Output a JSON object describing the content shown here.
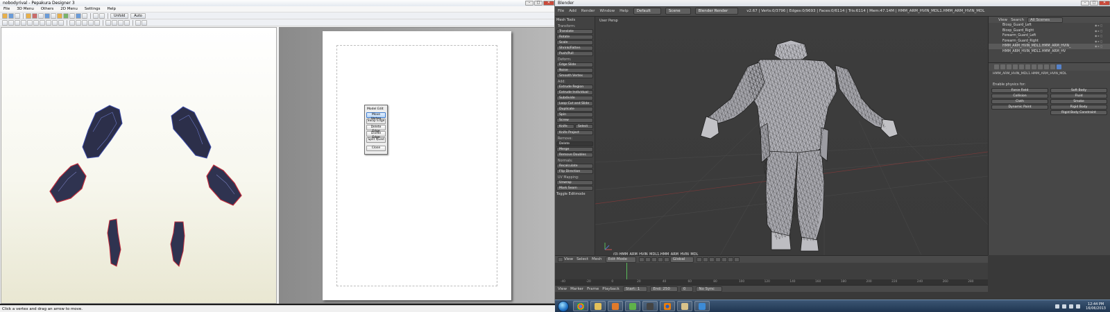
{
  "pepakura": {
    "title": "nobodyrival - Pepakura Designer 3",
    "menu": [
      "File",
      "3D Menu",
      "Others",
      "2D Menu",
      "Settings",
      "Help"
    ],
    "toolbar_labels": {
      "unfold": "Unfold",
      "auto": "Auto"
    },
    "model_edit": {
      "title": "Model Edit",
      "buttons": [
        "Move Vertex",
        "Swap Edge",
        "Delete Edge",
        "Divide Edge",
        "Split Quad"
      ],
      "close": "Close"
    },
    "status": "Click a vertex and drag an arrow to move."
  },
  "blender": {
    "title": "Blender",
    "menus": [
      "File",
      "Add",
      "Render",
      "Window",
      "Help"
    ],
    "layout": "Default",
    "scene": "Scene",
    "engine": "Blender Render",
    "stats": "v2.67 | Verts:0/3796 | Edges:0/9693 | Faces:0/6114 | Tris:6114 | Mem:47.14M | HMM_ARM_HVIN_MDL1.HMM_ARM_HVIN_MDL",
    "tools": {
      "header": "Mesh Tools",
      "sections": [
        {
          "title": "Transform:",
          "buttons": [
            "Translate",
            "Rotate",
            "Scale",
            "Shrink/Fatten",
            "Push/Pull"
          ]
        },
        {
          "title": "Deform:",
          "buttons": [
            "Edge Slide",
            "Noise",
            "Smooth Vertex"
          ]
        },
        {
          "title": "Add:",
          "buttons": [
            "Extrude Region",
            "Extrude Individual",
            "Subdivide",
            "Loop Cut and Slide",
            "Duplicate",
            "Spin",
            "Screw"
          ]
        },
        {
          "title": "",
          "buttons": [
            "Knife Project"
          ]
        },
        {
          "title": "Remove:",
          "buttons": [
            "Merge",
            "Remove Doubles"
          ]
        },
        {
          "title": "Normals:",
          "buttons": [
            "Recalculate",
            "Flip Direction"
          ]
        },
        {
          "title": "UV Mapping:",
          "buttons": [
            "Unwrap",
            "Mark Seam"
          ]
        }
      ],
      "knife": "Knife",
      "select": "Select",
      "delete": "Delete",
      "toggle": "Toggle Editmode"
    },
    "viewport": {
      "label": "User Persp",
      "object": "(0) HMM_ARM_HVIN_MDL1.HMM_ARM_HVIN_MDL"
    },
    "view_header": {
      "menus": [
        "View",
        "Select",
        "Mesh"
      ],
      "mode": "Edit Mode",
      "orientation": "Global"
    },
    "timeline": {
      "menus": [
        "View",
        "Marker",
        "Frame",
        "Playback"
      ],
      "start": "Start: 1",
      "end": "End: 250",
      "current": "0",
      "sync": "No Sync",
      "ruler": [
        "-40",
        "-20",
        "0",
        "20",
        "40",
        "60",
        "80",
        "100",
        "120",
        "140",
        "160",
        "180",
        "200",
        "220",
        "240",
        "260",
        "280"
      ]
    },
    "outliner": {
      "menus": [
        "View",
        "Search"
      ],
      "scope": "All Scenes",
      "items": [
        "Bicep_Guard_Left",
        "Bicep_Guard_Right",
        "Forearm_Guard_Left",
        "Forearm_Guard_Right",
        "HMM_ARM_HVIN_MDL1.HMM_ARM_HVIN_",
        "HMM_ARM_HVIN_MDL1.HMM_ARM_HV"
      ]
    },
    "properties": {
      "context": "HMM_ARM_HVIN_MDL1.HMM_ARM_HVIN_MDL",
      "subtitle": "Enable physics for:",
      "buttons": [
        "Force Field",
        "Soft Body",
        "Collision",
        "Fluid",
        "Cloth",
        "Smoke",
        "Dynamic Paint",
        "Rigid Body",
        "",
        "Rigid Body Constraint"
      ]
    }
  },
  "taskbar": {
    "time": "12:44 PM",
    "date": "16/06/2013"
  }
}
